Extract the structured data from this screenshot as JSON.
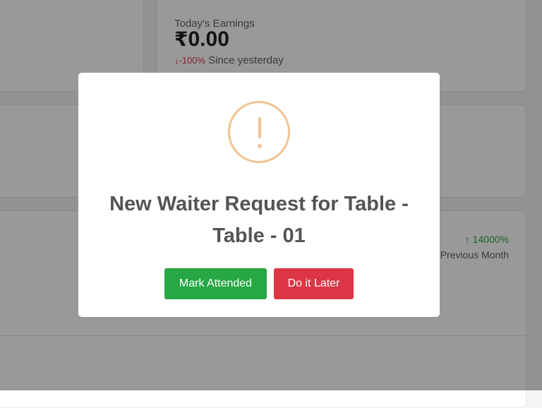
{
  "dashboard": {
    "earnings": {
      "label": "Today's Earnings",
      "currency_symbol": "₹",
      "amount": "0.00",
      "change_arrow": "↓",
      "change_value": "-100%",
      "change_text": "Since yesterday"
    },
    "monthly_stat": {
      "arrow": "↑",
      "change_value": "14000%",
      "change_text": "Previous Month"
    }
  },
  "modal": {
    "icon": "exclamation-icon",
    "title": "New Waiter Request for Table - Table - 01",
    "primary_button": "Mark Attended",
    "secondary_button": "Do it Later"
  },
  "colors": {
    "success": "#28a745",
    "danger": "#dc3545",
    "warning_icon": "#f2c394",
    "overlay": "rgba(0,0,0,0.40)"
  }
}
